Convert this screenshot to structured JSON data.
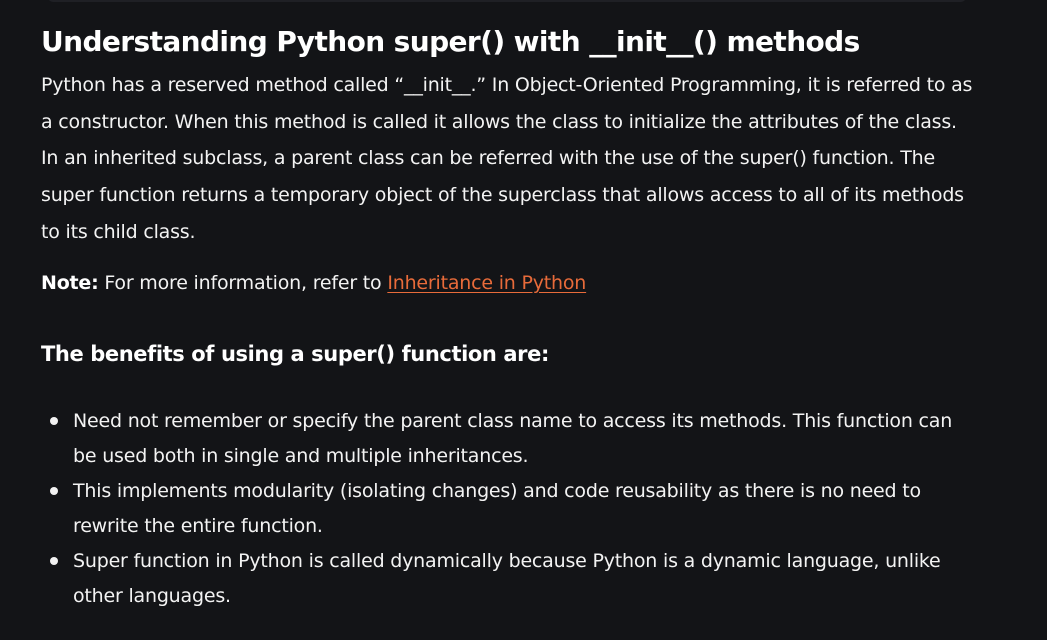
{
  "article": {
    "title": "Understanding Python super() with __init__() methods",
    "paragraph": "Python has a reserved method called “__init__.” In Object-Oriented Programming, it is referred to as a constructor. When this method is called it allows the class to initialize the attributes of the class. In an inherited subclass, a parent class can be referred with the use of the super() function. The super function returns a temporary object of the superclass that allows access to all of its methods to its child class.",
    "note_label": "Note:",
    "note_text": " For more information, refer to ",
    "note_link": "Inheritance in Python",
    "benefits_heading": "The benefits of using a super() function are:",
    "benefits": [
      "Need not remember or specify the parent class name to access its methods. This function can be used both in single and multiple inheritances.",
      "This implements modularity (isolating changes) and code reusability as there is no need to rewrite the entire function.",
      "Super function in Python is called dynamically because Python is a dynamic language, unlike other languages."
    ]
  },
  "colors": {
    "background": "#131417",
    "text": "#f3f3f3",
    "link": "#e86b3a"
  }
}
